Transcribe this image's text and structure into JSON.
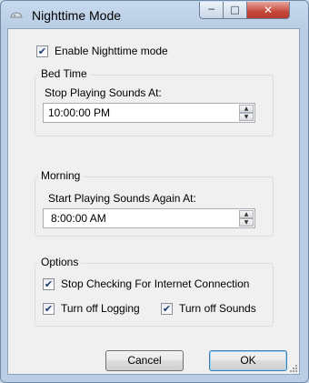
{
  "window": {
    "title": "Nighttime Mode",
    "minimize_glyph": "─",
    "maximize_glyph": "□",
    "close_glyph": "✕"
  },
  "enable": {
    "label": "Enable Nighttime mode",
    "checked": true
  },
  "bed_time": {
    "group_label": "Bed Time",
    "field_label": "Stop Playing Sounds At:",
    "value": "10:00:00 PM"
  },
  "morning": {
    "group_label": "Morning",
    "field_label": "Start Playing Sounds Again At:",
    "value": "8:00:00 AM"
  },
  "options": {
    "group_label": "Options",
    "stop_checking": {
      "label": "Stop Checking For Internet Connection",
      "checked": true
    },
    "logging": {
      "label": "Turn off Logging",
      "checked": true
    },
    "sounds": {
      "label": "Turn off Sounds",
      "checked": true
    }
  },
  "spinner": {
    "up_glyph": "▲",
    "down_glyph": "▼"
  },
  "check_glyph": "✔",
  "buttons": {
    "cancel": "Cancel",
    "ok": "OK"
  }
}
